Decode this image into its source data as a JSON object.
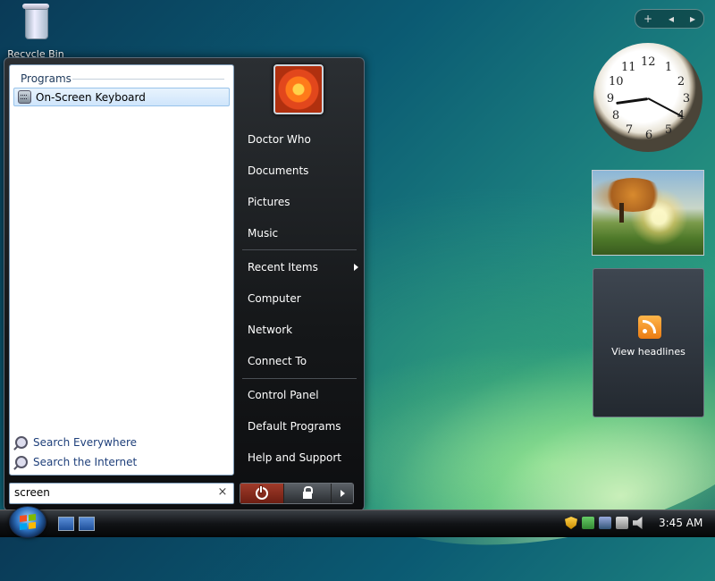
{
  "desktop": {
    "recycle_bin_label": "Recycle Bin"
  },
  "start_menu": {
    "programs_header": "Programs",
    "results": [
      {
        "label": "On-Screen Keyboard",
        "icon": "keyboard-icon"
      }
    ],
    "search_everywhere": "Search Everywhere",
    "search_internet": "Search the Internet",
    "search_value": "screen",
    "clear_glyph": "×",
    "right_items": [
      "Doctor Who",
      "Documents",
      "Pictures",
      "Music",
      "Recent Items",
      "Computer",
      "Network",
      "Connect To",
      "Control Panel",
      "Default Programs",
      "Help and Support"
    ]
  },
  "gadgets": {
    "toolbar_add": "+",
    "toolbar_prev": "◂",
    "toolbar_next": "▸",
    "clock_numbers": [
      "12",
      "1",
      "2",
      "3",
      "4",
      "5",
      "6",
      "7",
      "8",
      "9",
      "10",
      "11"
    ],
    "feed_label": "View headlines"
  },
  "taskbar": {
    "time": "3:45 AM"
  },
  "colors": {
    "accent": "#1e395b",
    "link": "#1e3f7a",
    "selection_border": "#98c3ea"
  }
}
